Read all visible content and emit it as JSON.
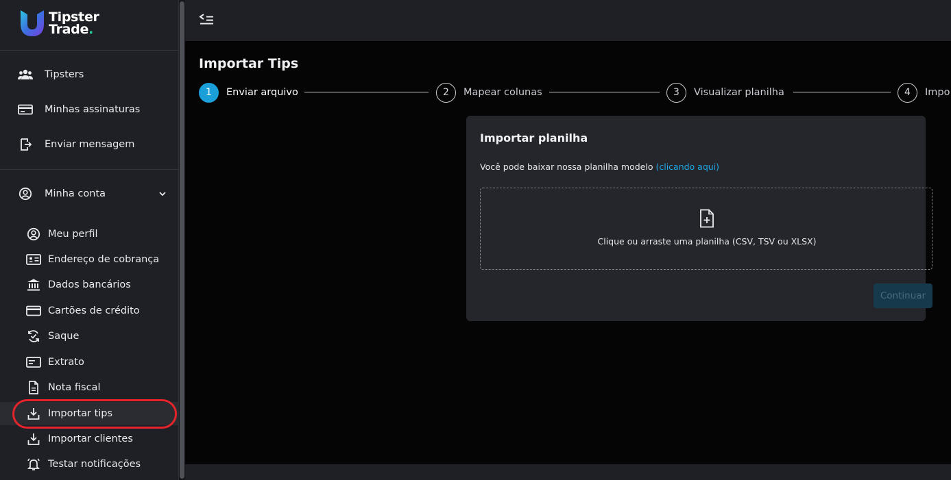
{
  "brand": {
    "line1": "Tipster",
    "line2": "Trade",
    "dot": ".",
    "accent": "#24d1a0"
  },
  "nav": {
    "main_items": [
      {
        "label": "Tipsters",
        "icon": "users-icon"
      },
      {
        "label": "Minhas assinaturas",
        "icon": "credit-card-icon"
      },
      {
        "label": "Enviar mensagem",
        "icon": "send-message-icon"
      }
    ],
    "account": {
      "label": "Minha conta",
      "icon": "user-circle-icon",
      "expanded": true
    },
    "account_items": [
      {
        "label": "Meu perfil",
        "icon": "user-circle-icon"
      },
      {
        "label": "Endereço de cobrança",
        "icon": "id-card-icon"
      },
      {
        "label": "Dados bancários",
        "icon": "bank-icon"
      },
      {
        "label": "Cartões de crédito",
        "icon": "credit-card-icon"
      },
      {
        "label": "Saque",
        "icon": "withdraw-icon"
      },
      {
        "label": "Extrato",
        "icon": "statement-icon"
      },
      {
        "label": "Nota fiscal",
        "icon": "document-icon"
      },
      {
        "label": "Importar tips",
        "icon": "download-tray-icon",
        "active": true
      },
      {
        "label": "Importar clientes",
        "icon": "download-tray-icon"
      },
      {
        "label": "Testar notificações",
        "icon": "bell-icon"
      }
    ]
  },
  "page": {
    "title": "Importar Tips"
  },
  "stepper": [
    {
      "number": "1",
      "label": "Enviar arquivo",
      "active": true
    },
    {
      "number": "2",
      "label": "Mapear colunas",
      "active": false
    },
    {
      "number": "3",
      "label": "Visualizar planilha",
      "active": false
    },
    {
      "number": "4",
      "label": "Impo",
      "active": false
    }
  ],
  "card": {
    "title": "Importar planilha",
    "subtitle": "Você pode baixar nossa planilha modelo",
    "link": "(clicando aqui)",
    "dropzone_text": "Clique ou arraste uma planilha (CSV, TSV ou XLSX)",
    "continue_label": "Continuar"
  },
  "colors": {
    "accent": "#1a9fd9",
    "highlight": "#e5242b"
  }
}
